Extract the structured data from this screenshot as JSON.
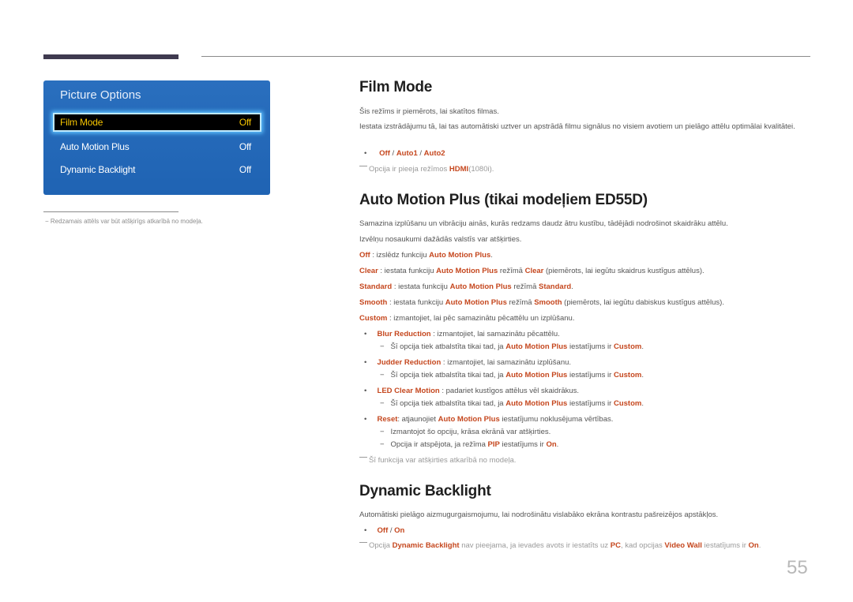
{
  "decor": {
    "accent": "#c5471e",
    "panel_color": "#2268b8",
    "highlight_text": "#f5c400"
  },
  "osd": {
    "title": "Picture Options",
    "items": [
      {
        "label": "Film Mode",
        "value": "Off",
        "selected": true
      },
      {
        "label": "Auto Motion Plus",
        "value": "Off",
        "selected": false
      },
      {
        "label": "Dynamic Backlight",
        "value": "Off",
        "selected": false
      }
    ]
  },
  "left_footnote": {
    "dash": "−",
    "text": "Redzamais attēls var būt atšķirīgs atkarībā no modeļa."
  },
  "film_mode": {
    "heading": "Film Mode",
    "p1": "Šis režīms ir piemērots, lai skatītos filmas.",
    "p2": "Iestata izstrādājumu tā, lai tas automātiski uztver un apstrādā filmu signālus no visiem avotiem un pielāgo attēlu optimālai kvalitātei.",
    "options": {
      "bullet": "•",
      "o1": "Off",
      "sep1": " / ",
      "o2": "Auto1",
      "sep2": " / ",
      "o3": "Auto2"
    },
    "note": {
      "pre": "Opcija ir pieeja režīmos ",
      "hl": "HDMI",
      "post": "(1080i)."
    }
  },
  "amp": {
    "heading": "Auto Motion Plus (tikai modeļiem ED55D)",
    "p1": "Samazina izplūšanu un vibrāciju ainās, kurās redzams daudz ātru kustību, tādējādi nodrošinot skaidrāku attēlu.",
    "p2": "Izvēlņu nosaukumi dažādās valstīs var atšķirties.",
    "off": {
      "k": "Off",
      "t1": " : izslēdz funkciju ",
      "h1": "Auto Motion Plus",
      "t2": "."
    },
    "clear": {
      "k": "Clear",
      "t1": " : iestata funkciju ",
      "h1": "Auto Motion Plus",
      "t2": " režīmā ",
      "h2": "Clear",
      "t3": " (piemērots, lai iegūtu skaidrus kustīgus attēlus)."
    },
    "standard": {
      "k": "Standard",
      "t1": " : iestata funkciju ",
      "h1": "Auto Motion Plus",
      "t2": " režīmā ",
      "h2": "Standard",
      "t3": "."
    },
    "smooth": {
      "k": "Smooth",
      "t1": " : iestata funkciju ",
      "h1": "Auto Motion Plus",
      "t2": " režīmā ",
      "h2": "Smooth",
      "t3": " (piemērots, lai iegūtu dabiskus kustīgus attēlus)."
    },
    "custom": {
      "k": "Custom",
      "t1": " : izmantojiet, lai pēc samazinātu pēcattēlu un izplūšanu."
    },
    "bullets": [
      {
        "k": "Blur Reduction",
        "t": " : izmantojiet, lai samazinātu pēcattēlu."
      },
      {
        "k": "Judder Reduction",
        "t": " : izmantojiet, lai samazinātu izplūšanu."
      },
      {
        "k": "LED Clear Motion",
        "t": " : padariet kustīgos attēlus vēl skaidrākus."
      }
    ],
    "sub_custom": {
      "dash": "−",
      "t1": "Šī opcija tiek atbalstīta tikai tad, ja ",
      "h1": "Auto Motion Plus",
      "t2": " iestatījums ir ",
      "h2": "Custom",
      "t3": "."
    },
    "reset": {
      "k": "Reset",
      "t1": ": atjaunojiet ",
      "h1": "Auto Motion Plus",
      "t2": " iestatījumu noklusējuma vērtības."
    },
    "reset_sub1": "Izmantojot šo opciju, krāsa ekrānā var atšķirties.",
    "reset_sub2": {
      "t1": "Opcija ir atspējota, ja režīma ",
      "h1": "PIP",
      "t2": " iestatījums ir ",
      "h2": "On",
      "t3": "."
    },
    "note": "Šī funkcija var atšķirties atkarībā no modeļa."
  },
  "dyn": {
    "heading": "Dynamic Backlight",
    "p1": "Automātiski pielāgo aizmugurgaismojumu, lai nodrošinātu vislabāko ekrāna kontrastu pašreizējos apstākļos.",
    "options": {
      "o1": "Off",
      "sep": " / ",
      "o2": "On"
    },
    "note": {
      "t1": "Opcija ",
      "h1": "Dynamic Backlight",
      "t2": " nav pieejama, ja ievades avots ir iestatīts uz ",
      "h2": "PC",
      "t3": ", kad opcijas ",
      "h3": "Video Wall",
      "t4": " iestatījums ir ",
      "h4": "On",
      "t5": "."
    }
  },
  "page_number": "55"
}
